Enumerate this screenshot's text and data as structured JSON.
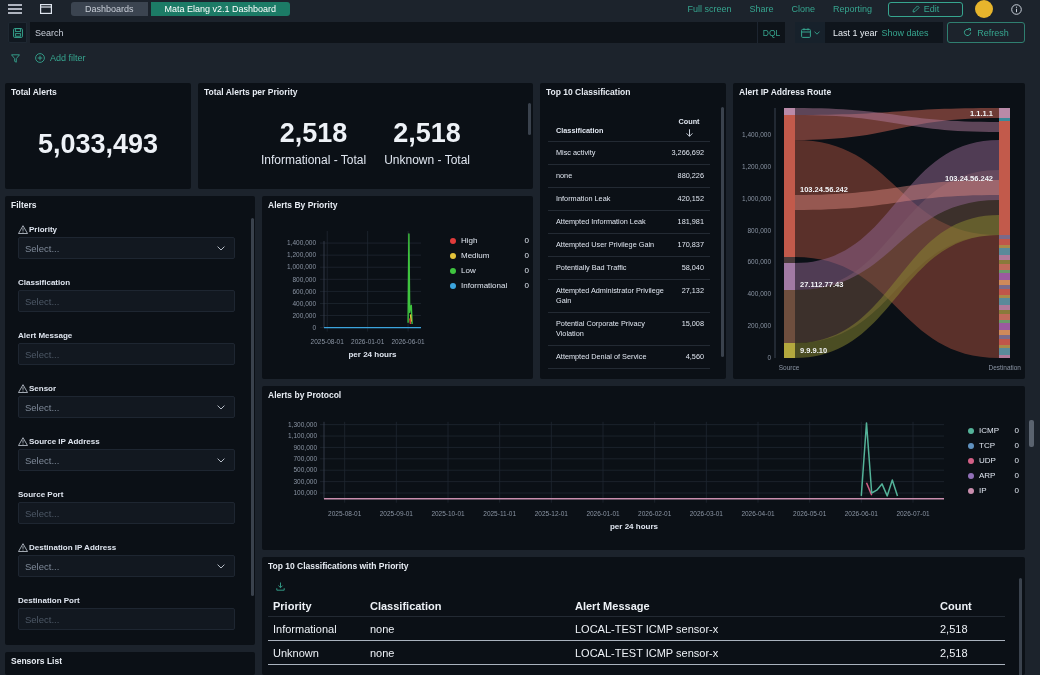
{
  "header": {
    "breadcrumbs": [
      {
        "label": "Dashboards",
        "selected": false
      },
      {
        "label": "Mata Elang v2.1 Dashboard",
        "selected": true
      }
    ],
    "actions": [
      "Full screen",
      "Share",
      "Clone",
      "Reporting"
    ],
    "edit_button": "Edit"
  },
  "query_bar": {
    "placeholder": "Search",
    "language": "DQL",
    "time_range": "Last 1 year",
    "show_dates": "Show dates",
    "refresh_button": "Refresh"
  },
  "filter_bar": {
    "add_filter": "Add filter"
  },
  "total_alerts": {
    "title": "Total Alerts",
    "value": "5,033,493"
  },
  "alerts_per_priority": {
    "title": "Total Alerts per Priority",
    "metrics": [
      {
        "value": "2,518",
        "label": "Informational - Total"
      },
      {
        "value": "2,518",
        "label": "Unknown - Total"
      }
    ]
  },
  "top_classification": {
    "title": "Top 10 Classification",
    "columns": [
      {
        "label": "Classification",
        "sorted": false
      },
      {
        "label": "Count",
        "sorted": true
      }
    ],
    "rows": [
      [
        "Misc activity",
        "3,266,692"
      ],
      [
        "none",
        "880,226"
      ],
      [
        "Information Leak",
        "420,152"
      ],
      [
        "Attempted Information Leak",
        "181,981"
      ],
      [
        "Attempted User Privilege Gain",
        "170,837"
      ],
      [
        "Potentially Bad Traffic",
        "58,040"
      ],
      [
        "Attempted Administrator Privilege Gain",
        "27,132"
      ],
      [
        "Potential Corporate Privacy Violation",
        "15,008"
      ],
      [
        "Attempted Denial of Service",
        "4,560"
      ]
    ]
  },
  "ip_route": {
    "title": "Alert IP Address Route",
    "y_tick_labels": [
      "1,400,000",
      "1,200,000",
      "1,000,000",
      "800,000",
      "600,000",
      "400,000",
      "200,000",
      "0"
    ],
    "source_nodes": [
      "103.24.56.242",
      "27.112.77.43",
      "9.9.9.10"
    ],
    "destination_nodes": [
      "1.1.1.1",
      "103.24.56.242"
    ],
    "axis_labels": [
      "Source",
      "Destination"
    ]
  },
  "filters": {
    "title": "Filters",
    "controls": [
      {
        "label": "Priority",
        "warning": true,
        "disabled": false,
        "placeholder": "Select..."
      },
      {
        "label": "Classification",
        "warning": false,
        "disabled": true,
        "placeholder": "Select..."
      },
      {
        "label": "Alert Message",
        "warning": false,
        "disabled": true,
        "placeholder": "Select..."
      },
      {
        "label": "Sensor",
        "warning": true,
        "disabled": false,
        "placeholder": "Select..."
      },
      {
        "label": "Source IP Address",
        "warning": true,
        "disabled": false,
        "placeholder": "Select..."
      },
      {
        "label": "Source Port",
        "warning": false,
        "disabled": true,
        "placeholder": "Select..."
      },
      {
        "label": "Destination IP Address",
        "warning": true,
        "disabled": false,
        "placeholder": "Select..."
      },
      {
        "label": "Destination Port",
        "warning": false,
        "disabled": true,
        "placeholder": "Select..."
      }
    ]
  },
  "alerts_by_priority": {
    "title": "Alerts By Priority",
    "chart_data": {
      "type": "line",
      "xlabel": "per 24 hours",
      "grid": true,
      "categories": [
        null,
        null,
        null,
        null,
        "2025-08-01",
        null,
        null,
        null,
        null,
        null,
        null,
        null,
        null,
        null,
        null,
        null,
        null,
        null,
        null,
        null,
        null,
        null,
        null,
        null,
        null,
        null,
        null,
        null,
        null,
        null,
        null,
        null,
        null,
        null,
        null,
        null,
        null,
        null,
        null,
        null,
        null,
        null,
        null,
        null,
        null,
        null,
        null,
        null,
        null,
        null,
        null,
        null,
        null,
        null,
        "2026-01-01",
        null,
        null,
        null,
        null,
        null,
        null,
        null,
        null,
        null,
        null,
        null,
        null,
        null,
        null,
        null,
        null,
        null,
        null,
        null,
        null,
        null,
        null,
        null,
        null,
        null,
        null,
        null,
        null,
        null,
        null,
        null,
        null,
        null,
        null,
        null,
        null,
        null,
        null,
        null,
        null,
        null,
        null,
        null,
        null,
        null,
        null,
        null,
        null,
        null,
        "2026-06-01",
        null,
        null,
        null,
        null,
        null,
        null,
        null,
        null,
        null,
        null,
        null,
        null,
        null,
        null,
        null,
        null
      ],
      "ylim": [
        0,
        1600000
      ],
      "yticks": [
        {
          "value": 0,
          "label": "0"
        },
        {
          "value": 200000,
          "label": "200,000"
        },
        {
          "value": 400000,
          "label": "400,000"
        },
        {
          "value": 600000,
          "label": "600,000"
        },
        {
          "value": 800000,
          "label": "800,000"
        },
        {
          "value": 1000000,
          "label": "1,000,000"
        },
        {
          "value": 1200000,
          "label": "1,200,000"
        },
        {
          "value": 1400000,
          "label": "1,400,000"
        }
      ],
      "series": [
        {
          "name": "High",
          "color": "#e03b3b",
          "values": [
            null,
            null,
            null,
            null,
            null,
            null,
            null,
            null,
            null,
            null,
            null,
            null,
            null,
            null,
            null,
            null,
            null,
            null,
            null,
            null,
            null,
            null,
            null,
            null,
            null,
            null,
            null,
            null,
            null,
            null,
            null,
            null,
            null,
            null,
            null,
            null,
            null,
            null,
            null,
            null,
            null,
            null,
            null,
            null,
            null,
            null,
            null,
            null,
            null,
            null,
            null,
            null,
            null,
            null,
            null,
            null,
            null,
            null,
            null,
            null,
            null,
            null,
            null,
            null,
            null,
            null,
            null,
            null,
            null,
            null,
            null,
            null,
            null,
            null,
            null,
            null,
            null,
            null,
            null,
            null,
            null,
            null,
            null,
            null,
            null,
            null,
            null,
            null,
            null,
            null,
            null,
            null,
            null,
            null,
            null,
            null,
            null,
            null,
            null,
            null,
            null,
            null,
            null,
            null,
            null,
            null,
            150000,
            60000,
            null,
            null,
            null,
            null,
            null,
            null,
            null,
            null,
            null,
            null,
            null,
            null,
            null
          ]
        },
        {
          "name": "Medium",
          "color": "#e2c23a",
          "values": [
            null,
            null,
            null,
            null,
            null,
            null,
            null,
            null,
            null,
            null,
            null,
            null,
            null,
            null,
            null,
            null,
            null,
            null,
            null,
            null,
            null,
            null,
            null,
            null,
            null,
            null,
            null,
            null,
            null,
            null,
            null,
            null,
            null,
            null,
            null,
            null,
            null,
            null,
            null,
            null,
            null,
            null,
            null,
            null,
            null,
            null,
            null,
            null,
            null,
            null,
            null,
            null,
            null,
            null,
            null,
            null,
            null,
            null,
            null,
            null,
            null,
            null,
            null,
            null,
            null,
            null,
            null,
            null,
            null,
            null,
            null,
            null,
            null,
            null,
            null,
            null,
            null,
            null,
            null,
            null,
            null,
            null,
            null,
            null,
            null,
            null,
            null,
            null,
            null,
            null,
            null,
            null,
            null,
            null,
            null,
            null,
            null,
            null,
            null,
            null,
            null,
            null,
            null,
            null,
            null,
            null,
            null,
            220000,
            100000,
            null,
            null,
            null,
            null,
            null,
            null,
            null,
            null,
            null,
            null,
            null,
            null
          ]
        },
        {
          "name": "Low",
          "color": "#3fc43f",
          "values": [
            null,
            null,
            null,
            null,
            null,
            null,
            null,
            null,
            null,
            null,
            null,
            null,
            null,
            null,
            null,
            null,
            null,
            null,
            null,
            null,
            null,
            null,
            null,
            null,
            null,
            null,
            null,
            null,
            null,
            null,
            null,
            null,
            null,
            null,
            null,
            null,
            null,
            null,
            null,
            null,
            null,
            null,
            null,
            null,
            null,
            null,
            null,
            null,
            null,
            null,
            null,
            null,
            null,
            null,
            null,
            null,
            null,
            null,
            null,
            null,
            null,
            null,
            null,
            null,
            null,
            null,
            null,
            null,
            null,
            null,
            null,
            null,
            null,
            null,
            null,
            null,
            null,
            null,
            null,
            null,
            null,
            null,
            null,
            null,
            null,
            null,
            null,
            null,
            null,
            null,
            null,
            null,
            null,
            null,
            null,
            null,
            null,
            null,
            null,
            null,
            null,
            null,
            null,
            null,
            80000,
            1550000,
            250000,
            330000,
            370000,
            60000,
            null,
            null,
            null,
            null,
            null,
            null,
            null,
            null,
            null,
            null,
            null
          ]
        },
        {
          "name": "Informational",
          "color": "#3ba4dd",
          "values": [
            0,
            0,
            0,
            0,
            0,
            0,
            0,
            0,
            0,
            0,
            0,
            0,
            0,
            0,
            0,
            0,
            0,
            0,
            0,
            0,
            0,
            0,
            0,
            0,
            0,
            0,
            0,
            0,
            0,
            0,
            0,
            0,
            0,
            0,
            0,
            0,
            0,
            0,
            0,
            0,
            0,
            0,
            0,
            0,
            0,
            0,
            0,
            0,
            0,
            0,
            0,
            0,
            0,
            0,
            0,
            0,
            0,
            0,
            0,
            0,
            0,
            0,
            0,
            0,
            0,
            0,
            0,
            0,
            0,
            0,
            0,
            0,
            0,
            0,
            0,
            0,
            0,
            0,
            0,
            0,
            0,
            0,
            0,
            0,
            0,
            0,
            0,
            0,
            0,
            0,
            0,
            0,
            0,
            0,
            0,
            0,
            0,
            0,
            0,
            0,
            0,
            0,
            0,
            0,
            0,
            0,
            0,
            0,
            0,
            0,
            0,
            0,
            0,
            0,
            0,
            0,
            0,
            0,
            0,
            0,
            0
          ]
        }
      ]
    },
    "legend_values": [
      "0",
      "0",
      "0",
      "0"
    ]
  },
  "alerts_by_protocol": {
    "title": "Alerts by Protocol",
    "chart_data": {
      "type": "line",
      "xlabel": "per 24 hours",
      "grid": true,
      "categories": [
        null,
        null,
        null,
        null,
        "2025-08-01",
        null,
        null,
        null,
        null,
        null,
        null,
        null,
        null,
        null,
        "2025-09-01",
        null,
        null,
        null,
        null,
        null,
        null,
        null,
        null,
        null,
        "2025-10-01",
        null,
        null,
        null,
        null,
        null,
        null,
        null,
        null,
        null,
        "2025-11-01",
        null,
        null,
        null,
        null,
        null,
        null,
        null,
        null,
        null,
        "2025-12-01",
        null,
        null,
        null,
        null,
        null,
        null,
        null,
        null,
        null,
        "2026-01-01",
        null,
        null,
        null,
        null,
        null,
        null,
        null,
        null,
        null,
        "2026-02-01",
        null,
        null,
        null,
        null,
        null,
        null,
        null,
        null,
        null,
        "2026-03-01",
        null,
        null,
        null,
        null,
        null,
        null,
        null,
        null,
        null,
        "2026-04-01",
        null,
        null,
        null,
        null,
        null,
        null,
        null,
        null,
        null,
        "2026-05-01",
        null,
        null,
        null,
        null,
        null,
        null,
        null,
        null,
        null,
        "2026-06-01",
        null,
        null,
        null,
        null,
        null,
        null,
        null,
        null,
        null,
        "2026-07-01",
        null,
        null,
        null,
        null,
        null,
        null
      ],
      "ylim": [
        0,
        1350000
      ],
      "yticks": [
        {
          "value": 100000,
          "label": "100,000"
        },
        {
          "value": 300000,
          "label": "300,000"
        },
        {
          "value": 500000,
          "label": "500,000"
        },
        {
          "value": 700000,
          "label": "700,000"
        },
        {
          "value": 900000,
          "label": "900,000"
        },
        {
          "value": 1100000,
          "label": "1,100,000"
        },
        {
          "value": 1300000,
          "label": "1,300,000"
        }
      ],
      "series": [
        {
          "name": "ICMP",
          "color": "#54b399",
          "values": [
            null,
            null,
            null,
            null,
            null,
            null,
            null,
            null,
            null,
            null,
            null,
            null,
            null,
            null,
            null,
            null,
            null,
            null,
            null,
            null,
            null,
            null,
            null,
            null,
            null,
            null,
            null,
            null,
            null,
            null,
            null,
            null,
            null,
            null,
            null,
            null,
            null,
            null,
            null,
            null,
            null,
            null,
            null,
            null,
            null,
            null,
            null,
            null,
            null,
            null,
            null,
            null,
            null,
            null,
            null,
            null,
            null,
            null,
            null,
            null,
            null,
            null,
            null,
            null,
            null,
            null,
            null,
            null,
            null,
            null,
            null,
            null,
            null,
            null,
            null,
            null,
            null,
            null,
            null,
            null,
            null,
            null,
            null,
            null,
            null,
            null,
            null,
            null,
            null,
            null,
            null,
            null,
            null,
            null,
            null,
            null,
            null,
            null,
            null,
            null,
            null,
            null,
            null,
            null,
            50000,
            1330000,
            100000,
            150000,
            260000,
            50000,
            330000,
            50000,
            null,
            null,
            null,
            null,
            null,
            null,
            null,
            null,
            null
          ]
        },
        {
          "name": "TCP",
          "color": "#6092c0",
          "values": [
            null,
            null,
            null,
            null,
            null,
            null,
            null,
            null,
            null,
            null,
            null,
            null,
            null,
            null,
            null,
            null,
            null,
            null,
            null,
            null,
            null,
            null,
            null,
            null,
            null,
            null,
            null,
            null,
            null,
            null,
            null,
            null,
            null,
            null,
            null,
            null,
            null,
            null,
            null,
            null,
            null,
            null,
            null,
            null,
            null,
            null,
            null,
            null,
            null,
            null,
            null,
            null,
            null,
            null,
            null,
            null,
            null,
            null,
            null,
            null,
            null,
            null,
            null,
            null,
            null,
            null,
            null,
            null,
            null,
            null,
            null,
            null,
            null,
            null,
            null,
            null,
            null,
            null,
            null,
            null,
            null,
            null,
            null,
            null,
            null,
            null,
            null,
            null,
            null,
            null,
            null,
            null,
            null,
            null,
            null,
            null,
            null,
            null,
            null,
            null,
            null,
            null,
            null,
            null,
            null,
            null,
            null,
            null,
            null,
            null,
            null,
            null,
            null,
            null,
            null,
            null,
            null,
            null,
            null,
            null,
            null
          ]
        },
        {
          "name": "UDP",
          "color": "#d36086",
          "values": [
            null,
            null,
            null,
            null,
            null,
            null,
            null,
            null,
            null,
            null,
            null,
            null,
            null,
            null,
            null,
            null,
            null,
            null,
            null,
            null,
            null,
            null,
            null,
            null,
            null,
            null,
            null,
            null,
            null,
            null,
            null,
            null,
            null,
            null,
            null,
            null,
            null,
            null,
            null,
            null,
            null,
            null,
            null,
            null,
            null,
            null,
            null,
            null,
            null,
            null,
            null,
            null,
            null,
            null,
            null,
            null,
            null,
            null,
            null,
            null,
            null,
            null,
            null,
            null,
            null,
            null,
            null,
            null,
            null,
            null,
            null,
            null,
            null,
            null,
            null,
            null,
            null,
            null,
            null,
            null,
            null,
            null,
            null,
            null,
            null,
            null,
            null,
            null,
            null,
            null,
            null,
            null,
            null,
            null,
            null,
            null,
            null,
            null,
            null,
            null,
            null,
            null,
            null,
            null,
            null,
            280000,
            60000,
            null,
            null,
            null,
            null,
            null,
            null,
            null,
            null,
            null,
            null,
            null,
            null,
            null,
            null
          ]
        },
        {
          "name": "ARP",
          "color": "#9170b8",
          "values": [
            null,
            null,
            null,
            null,
            null,
            null,
            null,
            null,
            null,
            null,
            null,
            null,
            null,
            null,
            null,
            null,
            null,
            null,
            null,
            null,
            null,
            null,
            null,
            null,
            null,
            null,
            null,
            null,
            null,
            null,
            null,
            null,
            null,
            null,
            null,
            null,
            null,
            null,
            null,
            null,
            null,
            null,
            null,
            null,
            null,
            null,
            null,
            null,
            null,
            null,
            null,
            null,
            null,
            null,
            null,
            null,
            null,
            null,
            null,
            null,
            null,
            null,
            null,
            null,
            null,
            null,
            null,
            null,
            null,
            null,
            null,
            null,
            null,
            null,
            null,
            null,
            null,
            null,
            null,
            null,
            null,
            null,
            null,
            null,
            null,
            null,
            null,
            null,
            null,
            null,
            null,
            null,
            null,
            null,
            null,
            null,
            null,
            null,
            null,
            null,
            null,
            null,
            null,
            null,
            null,
            null,
            null,
            null,
            null,
            null,
            null,
            null,
            null,
            null,
            null,
            null,
            null,
            null,
            null,
            null,
            null
          ]
        },
        {
          "name": "IP",
          "color": "#ca8eae",
          "values": [
            0,
            0,
            0,
            0,
            0,
            0,
            0,
            0,
            0,
            0,
            0,
            0,
            0,
            0,
            0,
            0,
            0,
            0,
            0,
            0,
            0,
            0,
            0,
            0,
            0,
            0,
            0,
            0,
            0,
            0,
            0,
            0,
            0,
            0,
            0,
            0,
            0,
            0,
            0,
            0,
            0,
            0,
            0,
            0,
            0,
            0,
            0,
            0,
            0,
            0,
            0,
            0,
            0,
            0,
            0,
            0,
            0,
            0,
            0,
            0,
            0,
            0,
            0,
            0,
            0,
            0,
            0,
            0,
            0,
            0,
            0,
            0,
            0,
            0,
            0,
            0,
            0,
            0,
            0,
            0,
            0,
            0,
            0,
            0,
            0,
            0,
            0,
            0,
            0,
            0,
            0,
            0,
            0,
            0,
            0,
            0,
            0,
            0,
            0,
            0,
            0,
            0,
            0,
            0,
            0,
            0,
            0,
            0,
            0,
            0,
            0,
            0,
            0,
            0,
            0,
            0,
            0,
            0,
            0,
            0,
            0
          ]
        }
      ]
    },
    "legend_values": [
      "0",
      "0",
      "0",
      "0",
      "0"
    ]
  },
  "classifications_with_priority": {
    "title": "Top 10 Classifications with Priority",
    "columns": [
      "Priority",
      "Classification",
      "Alert Message",
      "Count"
    ],
    "rows": [
      [
        "Informational",
        "none",
        "LOCAL-TEST ICMP sensor-x",
        "2,518"
      ],
      [
        "Unknown",
        "none",
        "LOCAL-TEST ICMP sensor-x",
        "2,518"
      ]
    ]
  },
  "sensors_list": {
    "title": "Sensors List"
  }
}
